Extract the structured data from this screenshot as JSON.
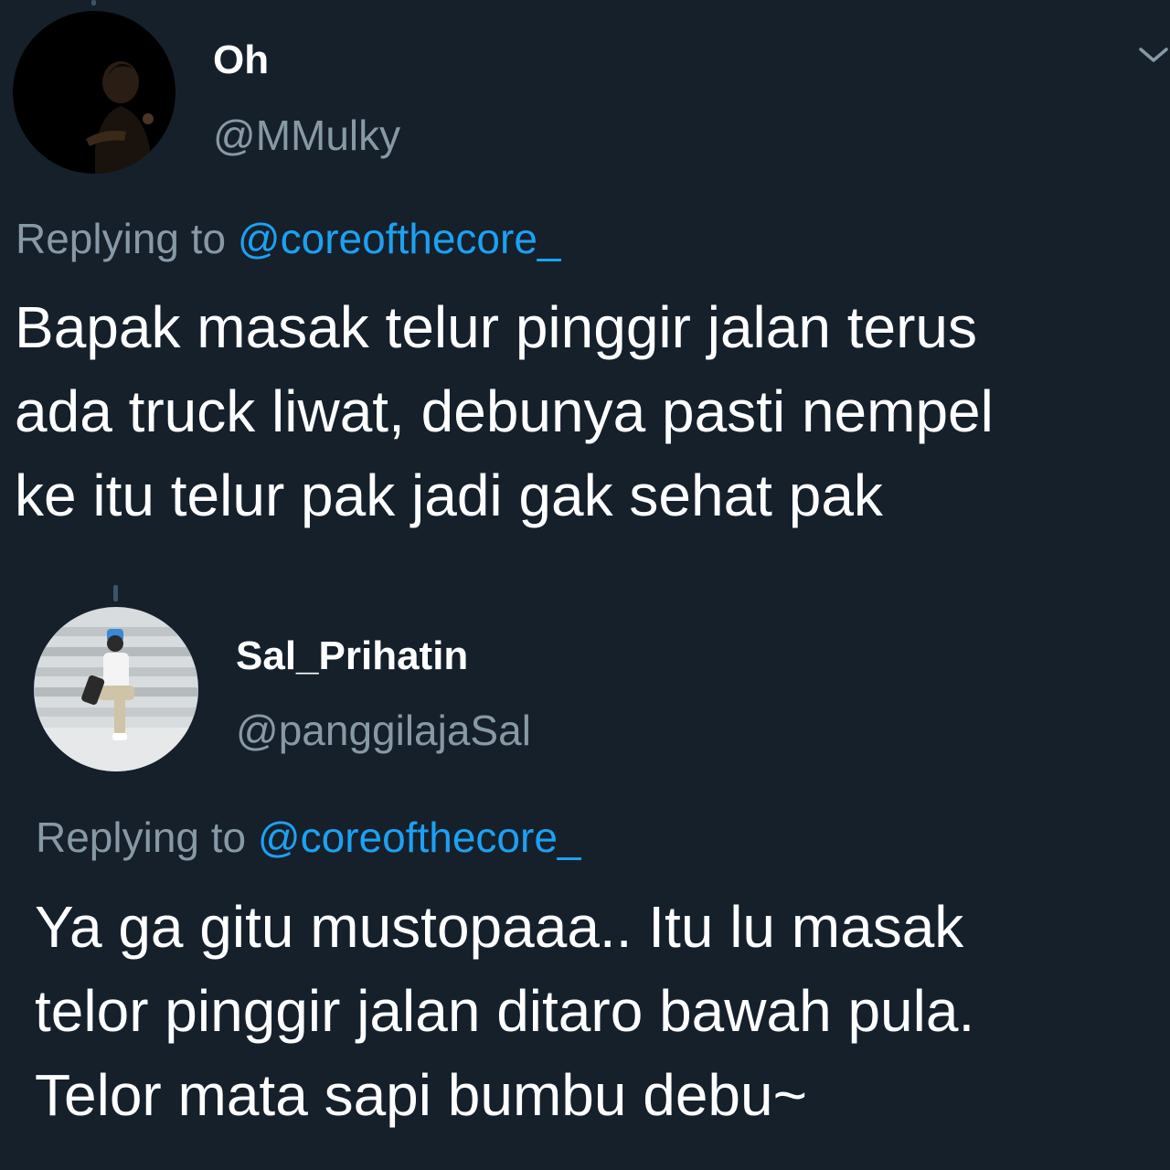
{
  "tweets": [
    {
      "display_name": "Oh",
      "handle": "@MMulky",
      "replying_prefix": "Replying to",
      "replying_to": "@coreofthecore_",
      "text": "Bapak masak telur pinggir jalan terus\nada truck liwat, debunya pasti nempel\nke itu telur pak jadi gak sehat pak"
    },
    {
      "display_name": "Sal_Prihatin",
      "handle": "@panggilajaSal",
      "replying_prefix": "Replying to",
      "replying_to": "@coreofthecore_",
      "text": "Ya ga gitu mustopaaa.. Itu lu masak\ntelor pinggir jalan ditaro bawah pula.\nTelor mata sapi bumbu debu~"
    }
  ],
  "icons": {
    "more_menu": "chevron-down-icon"
  },
  "colors": {
    "background": "#15202b",
    "primary_text": "#ffffff",
    "secondary_text": "#8899a6",
    "link": "#1da1f2"
  }
}
